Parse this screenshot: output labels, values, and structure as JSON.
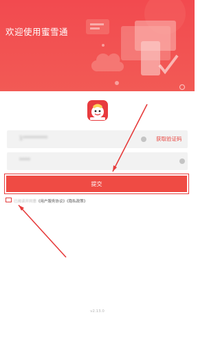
{
  "header": {
    "welcome": "欢迎使用蜜雪通"
  },
  "form": {
    "phone_value": "1*********",
    "code_value": "****",
    "get_code_label": "获取验证码",
    "submit_label": "提交"
  },
  "agreement": {
    "prefix": "已阅读并同意",
    "user_agreement": "《用户服务协议》",
    "privacy_policy": "《隐私政策》"
  },
  "version": "v2.13.0",
  "colors": {
    "brand": "#ef4b44",
    "annotation": "#e63b3b"
  }
}
